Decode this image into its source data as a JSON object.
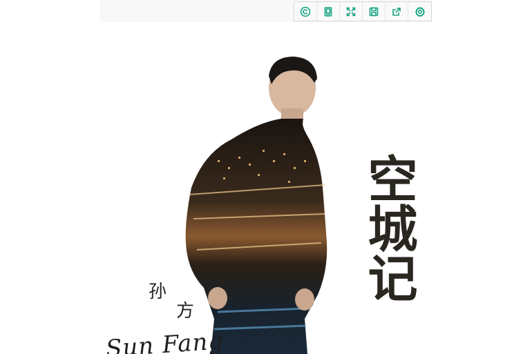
{
  "toolbar": {
    "accent": "#14a37f",
    "buttons": [
      {
        "icon": "copyright-icon"
      },
      {
        "icon": "copy-icon"
      },
      {
        "icon": "fullscreen-icon"
      },
      {
        "icon": "save-icon"
      },
      {
        "icon": "share-icon"
      },
      {
        "icon": "settings-icon"
      }
    ]
  },
  "artwork": {
    "title_chars": "空城记",
    "artist_cn_1": "孙",
    "artist_cn_2": "方",
    "artist_en": "Sun Fang"
  }
}
